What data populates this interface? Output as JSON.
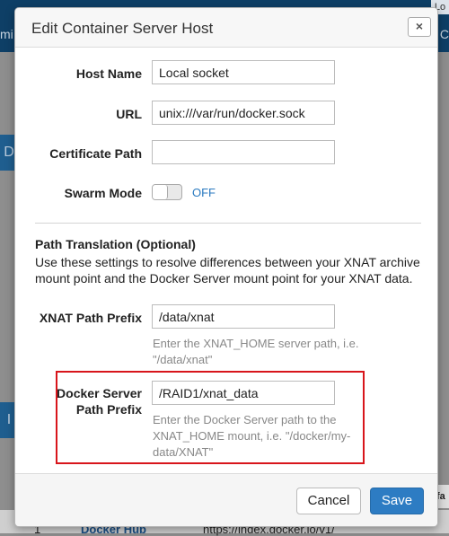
{
  "background": {
    "top_left_text": "mi",
    "top_right_text": "Lo",
    "top_right_text_2": "C",
    "panel_1_letter": "D",
    "panel_2_letter": "I",
    "table_row_number": "1",
    "table_row_name": "Docker Hub",
    "table_row_url": "https://index.docker.io/v1/",
    "right_cell_text": "fa"
  },
  "modal": {
    "title": "Edit Container Server Host",
    "close_label": "×"
  },
  "form": {
    "host_name": {
      "label": "Host Name",
      "value": "Local socket"
    },
    "url": {
      "label": "URL",
      "value": "unix:///var/run/docker.sock"
    },
    "certificate_path": {
      "label": "Certificate Path",
      "value": ""
    },
    "swarm_mode": {
      "label": "Swarm Mode",
      "state": "OFF"
    }
  },
  "path_translation": {
    "title": "Path Translation (Optional)",
    "description": "Use these settings to resolve differences between your XNAT archive mount point and the Docker Server mount point for your XNAT data.",
    "xnat_prefix": {
      "label": "XNAT Path Prefix",
      "value": "/data/xnat",
      "help": "Enter the XNAT_HOME server path, i.e. \"/data/xnat\""
    },
    "docker_prefix": {
      "label_line1": "Docker Server",
      "label_line2": "Path Prefix",
      "value": "/RAID1/xnat_data",
      "help": "Enter the Docker Server path to the XNAT_HOME mount, i.e. \"/docker/my-data/XNAT\""
    }
  },
  "footer": {
    "cancel_label": "Cancel",
    "save_label": "Save"
  },
  "colors": {
    "primary_button": "#2d7cc3",
    "toggle_text": "#2a7ac0",
    "highlight_border": "#d8151b",
    "top_bar": "#0e3f66"
  }
}
